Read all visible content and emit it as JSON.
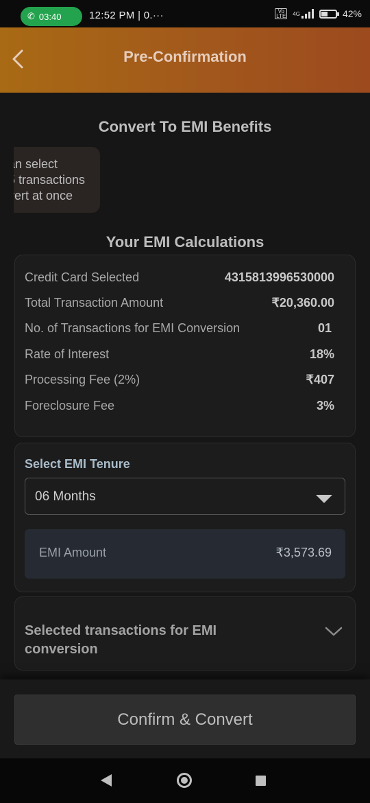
{
  "status_bar": {
    "call_time": "03:40",
    "time": "12:52 PM",
    "extra": "0.···",
    "network": "4G",
    "battery": "42%"
  },
  "header": {
    "title": "Pre-Confirmation",
    "back_icon": "chevron-left-icon"
  },
  "benefits": {
    "title": "Convert To EMI Benefits",
    "card_text": "an select\n5 transactions\nvert at once"
  },
  "calculations": {
    "title": "Your EMI Calculations",
    "rows": [
      {
        "label": "Credit Card Selected",
        "value": "4315813996530000"
      },
      {
        "label": "Total Transaction Amount",
        "value": "₹20,360.00"
      },
      {
        "label": "No. of Transactions for EMI Conversion",
        "value": "01"
      },
      {
        "label": "Rate of Interest",
        "value": "18%"
      },
      {
        "label": "Processing Fee (2%)",
        "value": "₹407"
      },
      {
        "label": "Foreclosure Fee",
        "value": "3%"
      }
    ]
  },
  "tenure": {
    "label": "Select EMI Tenure",
    "selected": "06 Months",
    "emi_label": "EMI Amount",
    "emi_value": "₹3,573.69"
  },
  "selected_transactions": {
    "label": "Selected transactions for EMI conversion"
  },
  "actions": {
    "confirm_label": "Confirm & Convert"
  }
}
